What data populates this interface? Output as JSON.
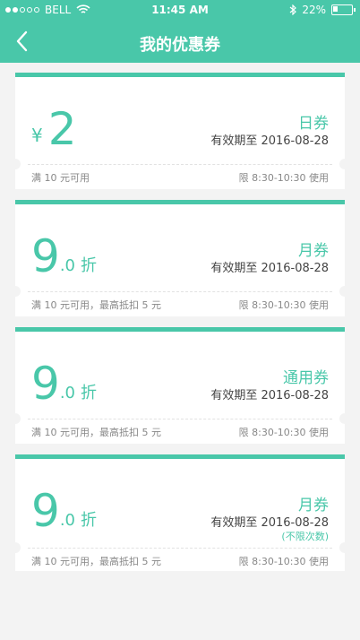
{
  "statusbar": {
    "carrier": "BELL",
    "time": "11:45 AM",
    "battery": "22%"
  },
  "nav": {
    "title": "我的优惠券"
  },
  "colors": {
    "accent": "#49c7a9",
    "background": "#f3f3f3"
  },
  "coupons": [
    {
      "currency": "¥",
      "amount": "2",
      "type": "日券",
      "validity": "有效期至 2016-08-28",
      "condition": "满 10 元可用",
      "time": "限 8:30-10:30 使用"
    },
    {
      "amount": "9",
      "amount_decimal": ".0",
      "unit": "折",
      "type": "月券",
      "validity": "有效期至 2016-08-28",
      "condition": "满 10 元可用，最高抵扣 5 元",
      "time": "限 8:30-10:30 使用"
    },
    {
      "amount": "9",
      "amount_decimal": ".0",
      "unit": "折",
      "type": "通用券",
      "validity": "有效期至 2016-08-28",
      "condition": "满 10 元可用，最高抵扣 5 元",
      "time": "限 8:30-10:30 使用"
    },
    {
      "amount": "9",
      "amount_decimal": ".0",
      "unit": "折",
      "type": "月券",
      "validity": "有效期至 2016-08-28",
      "extra": "(不限次数)",
      "condition": "满 10 元可用，最高抵扣 5 元",
      "time": "限 8:30-10:30 使用"
    }
  ]
}
